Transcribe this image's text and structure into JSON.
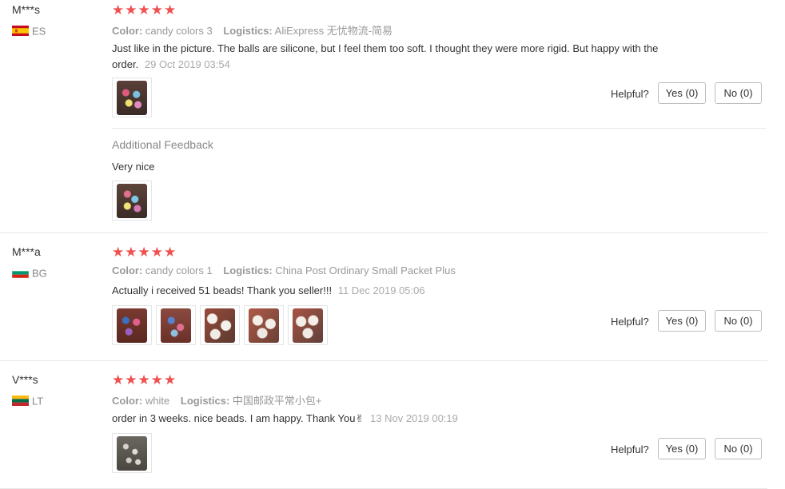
{
  "labels": {
    "color": "Color:",
    "logistics": "Logistics:",
    "helpful": "Helpful?",
    "additional_feedback": "Additional Feedback",
    "stars_text": "★★★★★"
  },
  "colors": {
    "star": "#ef5150",
    "muted_text": "#999999",
    "button_border": "#bdbdbd"
  },
  "reviews": [
    {
      "user": "M***s",
      "country": "ES",
      "flag": "spain-flag-icon",
      "rating": 5,
      "color": "candy colors 3",
      "logistics": "AliExpress 无忧物流-简易",
      "text": "Just like in the picture. The balls are silicone, but I feel them too soft. I thought they were more rigid. But happy with the order.",
      "date": "29 Oct 2019 03:54",
      "yes": "Yes (0)",
      "no": "No (0)",
      "additional_feedback": "Very nice"
    },
    {
      "user": "M***a",
      "country": "BG",
      "flag": "bulgaria-flag-icon",
      "rating": 5,
      "color": "candy colors 1",
      "logistics": "China Post Ordinary Small Packet Plus",
      "text": "Actually i received 51 beads! Thank you seller!!!",
      "date": "11 Dec 2019 05:06",
      "yes": "Yes (0)",
      "no": "No (0)"
    },
    {
      "user": "V***s",
      "country": "LT",
      "flag": "lithuania-flag-icon",
      "rating": 5,
      "color": "white",
      "logistics": "中国邮政平常小包+",
      "text": "order in 3 weeks. nice beads. I am happy. Thank You✌",
      "date": "13 Nov 2019 00:19",
      "yes": "Yes (0)",
      "no": "No (0)"
    }
  ]
}
